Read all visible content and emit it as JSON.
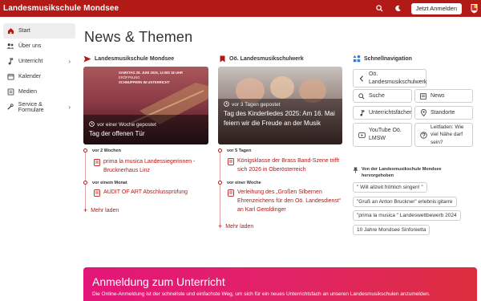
{
  "header": {
    "brand": "Landesmusikschule Mondsee",
    "login_label": "Jetzt Anmelden",
    "icons": [
      "search-icon",
      "dark-mode-icon",
      "crest-icon"
    ]
  },
  "sidebar": {
    "items": [
      {
        "label": "Start",
        "icon": "home-icon"
      },
      {
        "label": "Über uns",
        "icon": "users-icon"
      },
      {
        "label": "Unterricht",
        "icon": "music-icon",
        "chevron": "›"
      },
      {
        "label": "Kalender",
        "icon": "calendar-icon"
      },
      {
        "label": "Medien",
        "icon": "folder-icon"
      },
      {
        "label": "Service & Formulare",
        "icon": "tools-icon",
        "chevron": "›"
      }
    ]
  },
  "main": {
    "title": "News & Themen",
    "col1": {
      "heading": "Landesmusikschule Mondsee",
      "hero": {
        "meta": "vor einer Woche gepostet",
        "title": "Tag der offenen Tür",
        "poster_line1": "SAMSTAG 28. JUNI 2025, 14 BIS 18 UHR",
        "poster_line2": "ERÖFFNUNG",
        "poster_line3": "SCHNUPPERN IM UNTERRICHT"
      },
      "groups": [
        {
          "date": "vor 2 Wochen",
          "items": [
            "prima la musica Landessiegerinnen - Brucknerhaus Linz"
          ]
        },
        {
          "date": "vor einem Monat",
          "items": [
            "AUDIT OF ART Abschlussprüfung"
          ]
        }
      ],
      "more": "Mehr laden"
    },
    "col2": {
      "heading": "Oö. Landesmusikschulwerk",
      "hero": {
        "meta": "vor 3 Tagen gepostet",
        "title": "Tag des Kinderliedes 2025: Am 16. Mai feiern wir die Freude an der Musik"
      },
      "groups": [
        {
          "date": "vor 5 Tagen",
          "items": [
            "Königsklasse der Brass Band-Szene trifft sich 2026 in Oberösterreich"
          ]
        },
        {
          "date": "vor einer Woche",
          "items": [
            "Verleihung des „Großen Silbernen Ehrenzeichens für den Oö. Landesdienst“ an Karl Geroldinger"
          ]
        }
      ],
      "more": "Mehr laden"
    },
    "quicknav": {
      "heading": "Schnellnavigation",
      "back": "Oö. Landesmusikschulwerk",
      "buttons": [
        {
          "label": "Suche",
          "icon": "search-icon"
        },
        {
          "label": "News",
          "icon": "news-icon"
        },
        {
          "label": "Unterrichtsfächer",
          "icon": "music-icon"
        },
        {
          "label": "Standorte",
          "icon": "location-icon"
        },
        {
          "label": "YouTube Oö. LMSW",
          "icon": "video-icon"
        },
        {
          "label": "Leitfaden: Wie viel Nähe darf sein?",
          "icon": "help-icon"
        }
      ],
      "highlight_title": "Von der Landesmusikschule Mondsee hervorgehoben",
      "chips": [
        "\" Will allzeit fröhlich singen! \"",
        "\"Gruß an Anton Bruckner\" erlebnis:gitarre",
        "\"prima la musica \" Landeswettbewerb 2024",
        "10 Jahre Mondsee Sinfonietta"
      ]
    },
    "banner": {
      "title": "Anmeldung zum Unterricht",
      "text": "Die Online-Anmeldung ist der schnellste und einfachste Weg, um sich für ein neues Unterrichtsfach an unseren Landesmusikschulen anzumelden."
    }
  },
  "colors": {
    "brand": "#b11a17",
    "banner_start": "#e4157a",
    "banner_end": "#dc2e3d"
  }
}
